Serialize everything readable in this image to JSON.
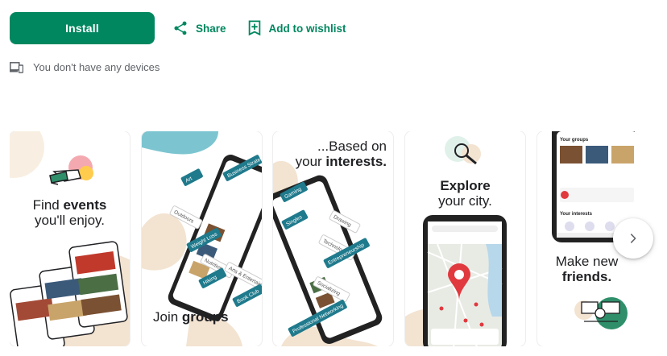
{
  "actions": {
    "install_label": "Install",
    "share_label": "Share",
    "wishlist_label": "Add to wishlist"
  },
  "devices": {
    "message": "You don't have any devices"
  },
  "screenshots": [
    {
      "caption_plain": "Find ",
      "caption_bold": "events",
      "caption_line2": "you'll enjoy."
    },
    {
      "caption_plain": "Join ",
      "caption_bold": "groups"
    },
    {
      "caption_line1": "...Based on",
      "caption_plain": "your ",
      "caption_bold": "interests."
    },
    {
      "caption_bold": "Explore",
      "caption_line2": "your city."
    },
    {
      "caption_line1": "Make new",
      "caption_bold": "friends."
    }
  ],
  "shot2_tags": [
    "Art",
    "Business Strategy",
    "Outdoors",
    "Weight Loss",
    "Nutrition",
    "Hiking",
    "Arts & Entertainment",
    "Book Club"
  ],
  "shot3_tags": [
    "Gaming",
    "Singles",
    "Drawing",
    "Technology",
    "Entrepreneurship",
    "Socializing",
    "Professional Networking"
  ],
  "shot5_phone": {
    "your_groups": "Your groups",
    "your_interests": "Your interests"
  },
  "colors": {
    "accent": "#01875f",
    "meetup_red": "#e0393e",
    "tag_teal": "#1f7a8c"
  },
  "icons": {
    "share": "share-icon",
    "wishlist": "bookmark-add-icon",
    "devices": "devices-icon",
    "next": "chevron-right-icon"
  }
}
